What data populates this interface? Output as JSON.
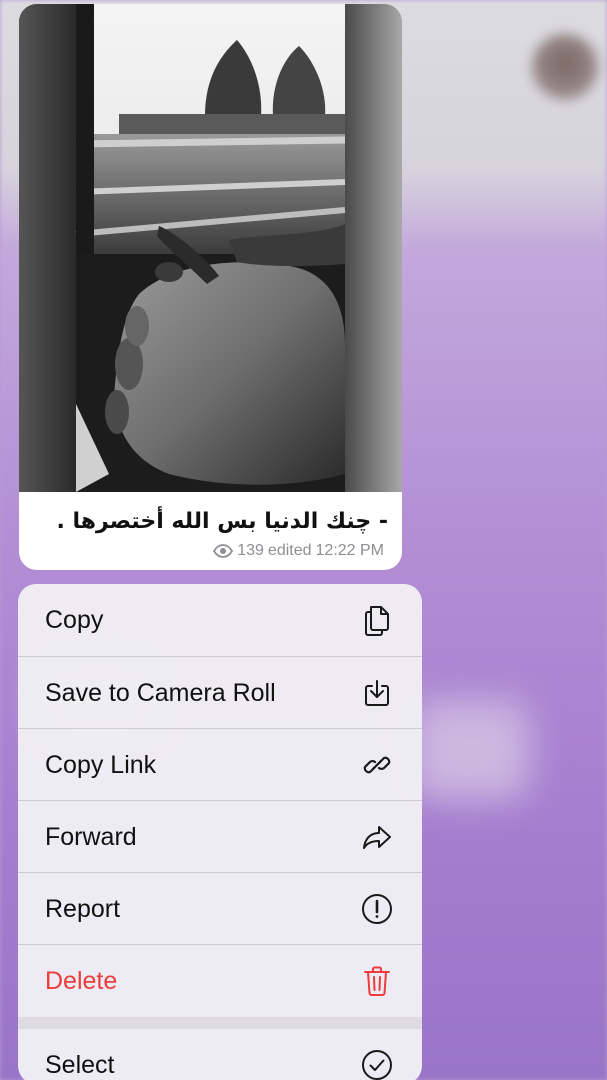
{
  "message": {
    "caption": "- چنك الدنيا بس الله أختصرها .",
    "views": "139",
    "status": "edited",
    "time": "12:22 PM"
  },
  "menu": {
    "items": [
      {
        "label": "Copy",
        "icon": "copy-icon"
      },
      {
        "label": "Save to Camera Roll",
        "icon": "download-icon"
      },
      {
        "label": "Copy Link",
        "icon": "link-icon"
      },
      {
        "label": "Forward",
        "icon": "forward-icon"
      },
      {
        "label": "Report",
        "icon": "exclamation-circle-icon"
      },
      {
        "label": "Delete",
        "icon": "trash-icon",
        "color": "#ee3b3b"
      },
      {
        "label": "Select",
        "icon": "checkmark-circle-icon"
      }
    ]
  }
}
